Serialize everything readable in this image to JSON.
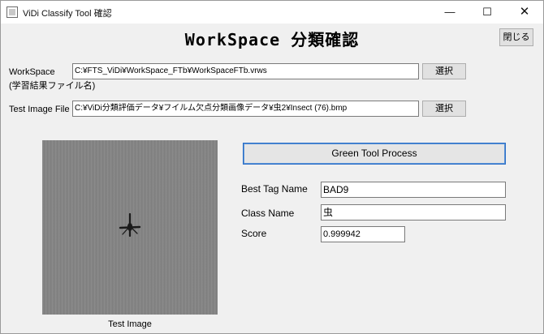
{
  "window": {
    "title": "ViDi Classify Tool 確認",
    "icon": "app-icon",
    "controls": {
      "minimize": "—",
      "maximize": "☐",
      "close": "✕"
    }
  },
  "heading": "WorkSpace 分類確認",
  "close_button": "閉じる",
  "workspace": {
    "label": "WorkSpace",
    "sublabel": "(学習結果ファイル名)",
    "path": "C:¥FTS_ViDi¥WorkSpace_FTb¥WorkSpaceFTb.vrws",
    "browse_label": "選択"
  },
  "test_image": {
    "label": "Test Image File",
    "path": "C:¥ViDi分類評価データ¥フイルム欠点分類画像データ¥虫2¥Insect (76).bmp",
    "browse_label": "選択",
    "caption": "Test Image"
  },
  "process_button": "Green Tool Process",
  "results": {
    "best_tag_label": "Best Tag Name",
    "best_tag_value": "BAD9",
    "class_label": "Class Name",
    "class_value": "虫",
    "score_label": "Score",
    "score_value": "0.999942"
  }
}
